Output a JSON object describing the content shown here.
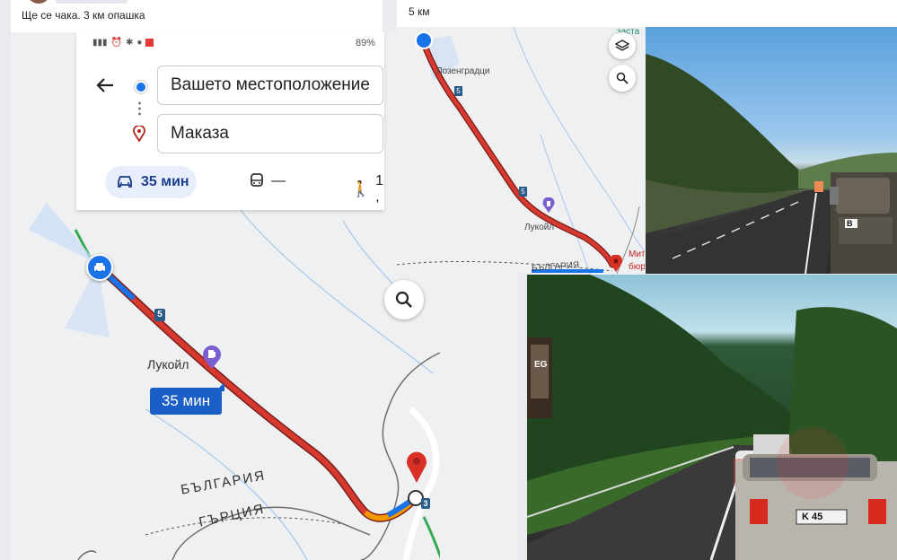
{
  "post_left": {
    "caption": "Ще се чака. 3 км опашка"
  },
  "post_right": {
    "caption": "5 км"
  },
  "phone": {
    "battery": "89%",
    "origin": "Вашето местоположение",
    "destination": "Маказа",
    "modes": {
      "car": "35 мин",
      "transit": "—",
      "walk": "1 ,"
    },
    "map_labels": {
      "station": "Лукойл",
      "duration_badge": "35 мин",
      "road_number": "5",
      "road_number_2": "3",
      "border_bg": "БЪЛГАРИЯ",
      "border_gr": "ГЪРЦИЯ"
    }
  },
  "small_map": {
    "village": "Лозенградци",
    "road_number": "5",
    "station": "Лукойл",
    "poi_top": "заста",
    "poi_mit": "Мит",
    "poi_byur": "бюр",
    "border": "БЪЛГАРИЯ"
  },
  "photos": {
    "top_plate": "B",
    "bottom_plate": "K 45",
    "billboard": "EG"
  },
  "colors": {
    "route": "#d6392f",
    "route_blue": "#1a73e8",
    "accent": "#1a3e8c",
    "pin": "#d93025"
  }
}
